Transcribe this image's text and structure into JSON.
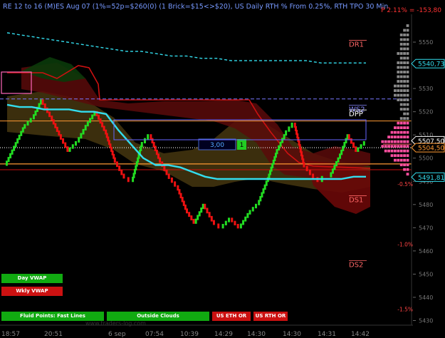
{
  "header": {
    "title": "RE 12 to 16 (M)ES Aug 07 (1%=52p=$260(0) (1 Brick=$15<>$20), US Daily RTH % From 0.25%, RTH TPO 30 Min",
    "pnl": "P 2.11% = -153,80"
  },
  "colors": {
    "bullish_brick": "#22dd22",
    "bearish_brick": "#ee1111",
    "vwap": "#33ddee",
    "pivot_line": "#ff9933",
    "ws2_line": "#7777ff",
    "profile_gray": "#8a8a8a",
    "profile_pink": "#ff4fa0"
  },
  "chart_data": {
    "type": "renko",
    "ylim": [
      5428,
      5562
    ],
    "y_ticks": [
      5430,
      5440,
      5450,
      5460,
      5470,
      5480,
      5490,
      5500,
      5510,
      5520,
      5530,
      5540,
      5550
    ],
    "x_labels": [
      "18:57",
      "20:51",
      "6 sep",
      "07:54",
      "10:39",
      "14:29",
      "14:30",
      "14:30",
      "14:31",
      "14:42"
    ],
    "price_tags": [
      {
        "label": "5540,73",
        "value": 5540.73,
        "color": "#33ddee"
      },
      {
        "label": "5507,50",
        "value": 5507.5,
        "color": "#ffffff"
      },
      {
        "label": "5504,50",
        "value": 5504.5,
        "color": "#ff9933"
      },
      {
        "label": "5491,81",
        "value": 5491.81,
        "color": "#33ddee"
      }
    ],
    "percent_labels": [
      {
        "label": "-0.5%",
        "value": 5488
      },
      {
        "label": "-1.0%",
        "value": 5462
      },
      {
        "label": "-1.5%",
        "value": 5434
      }
    ],
    "levels": [
      {
        "name": "DR1",
        "value": 5548
      },
      {
        "name": "WS2",
        "value": 5520
      },
      {
        "name": "DPP",
        "value": 5518
      },
      {
        "name": "DS1",
        "value": 5481
      },
      {
        "name": "DS2",
        "value": 5453
      }
    ],
    "series": [
      {
        "name": "Day VWAP",
        "y": [
          5523,
          5522,
          5522,
          5521,
          5521,
          5521,
          5520,
          5520,
          5519,
          5512,
          5506,
          5500,
          5497,
          5497,
          5496,
          5494,
          5492,
          5491,
          5491,
          5491,
          5491,
          5491,
          5491,
          5491,
          5491,
          5491,
          5491,
          5491,
          5492,
          5492
        ]
      },
      {
        "name": "Wkly VWAP",
        "y": [
          5554,
          5553,
          5552,
          5551,
          5550,
          5549,
          5548,
          5547,
          5546,
          5546,
          5545,
          5544,
          5544,
          5543,
          5543,
          5542,
          5542,
          5542,
          5542,
          5542,
          5542,
          5541,
          5541,
          5541,
          5541
        ]
      },
      {
        "name": "price",
        "y": [
          5497,
          5505,
          5513,
          5517,
          5525,
          5518,
          5510,
          5503,
          5507,
          5514,
          5520,
          5512,
          5500,
          5493,
          5490,
          5505,
          5510,
          5500,
          5493,
          5488,
          5478,
          5472,
          5480,
          5473,
          5470,
          5474,
          5470,
          5476,
          5480,
          5490,
          5502,
          5510,
          5515,
          5498,
          5493,
          5490,
          5492,
          5500,
          5510,
          5503,
          5507
        ]
      }
    ],
    "annotation": {
      "label": "3,00",
      "count": "1"
    }
  },
  "controls": [
    {
      "label": "Day VWAP",
      "color": "#11aa11"
    },
    {
      "label": "Wkly VWAP",
      "color": "#cc1111"
    },
    {
      "label": "Fluid Points: Fast Lines",
      "color": "#11aa11"
    },
    {
      "label": "Outside Clouds",
      "color": "#11aa11"
    },
    {
      "label": "US ETH OR",
      "color": "#cc1111"
    },
    {
      "label": "US RTH OR",
      "color": "#cc1111"
    }
  ],
  "watermark": "www.traders-log.com"
}
